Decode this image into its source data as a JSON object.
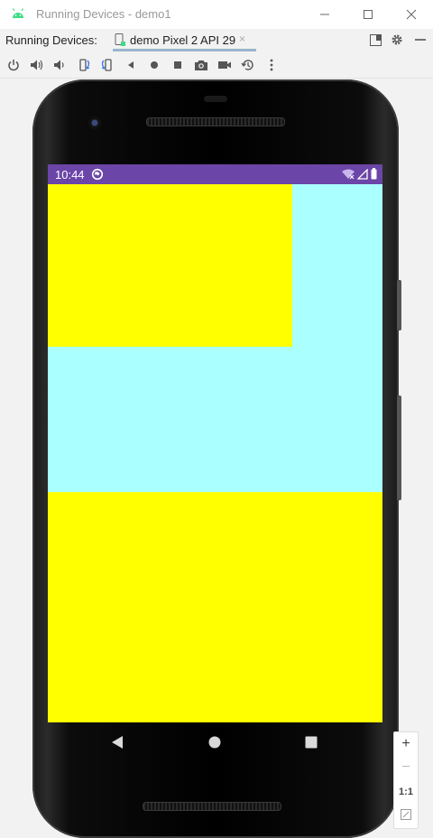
{
  "window": {
    "title": "Running Devices - demo1",
    "controls": [
      "minimize",
      "maximize",
      "close"
    ]
  },
  "tabs_row": {
    "label": "Running Devices:",
    "tab": {
      "label": "demo Pixel 2 API 29",
      "close": "×"
    }
  },
  "toolbar": {
    "icons": [
      "power-icon",
      "volume-up-icon",
      "volume-down-icon",
      "rotate-left-icon",
      "rotate-right-icon",
      "back-icon",
      "home-icon",
      "overview-icon",
      "screenshot-icon",
      "screen-record-icon",
      "snapshots-icon",
      "more-icon"
    ]
  },
  "device": {
    "status_bar": {
      "time": "10:44",
      "color": "#6b45a8"
    },
    "screen_background": "#aaffff",
    "box_color": "#ffff00"
  },
  "zoom_panel": {
    "zoom_in": "+",
    "zoom_out": "−",
    "actual_size": "1:1"
  }
}
